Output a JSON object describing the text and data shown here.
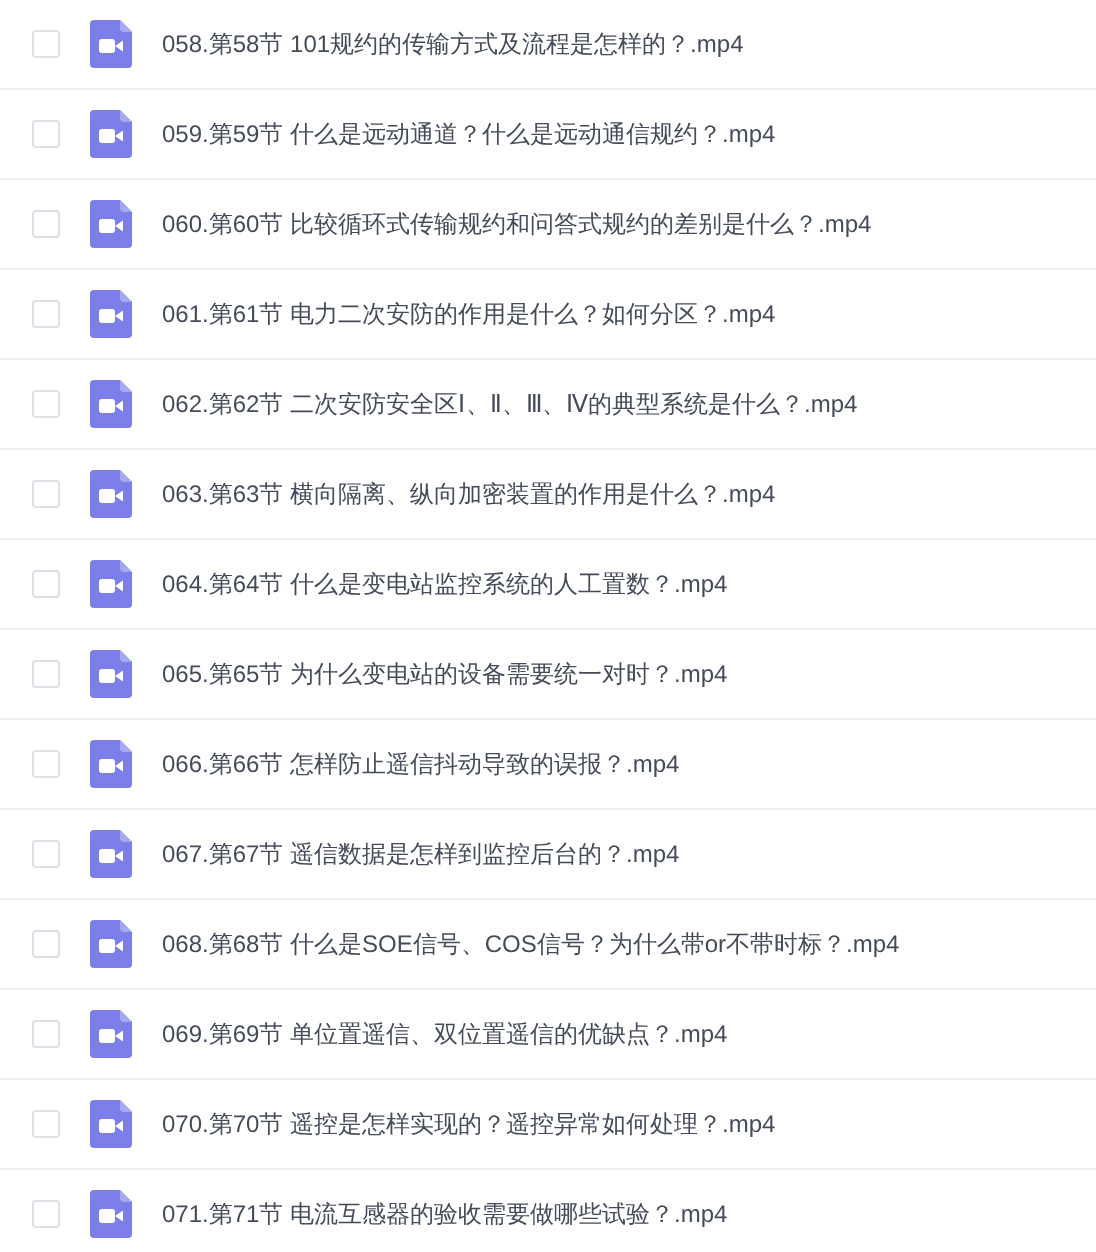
{
  "files": [
    {
      "name": "058.第58节 101规约的传输方式及流程是怎样的？.mp4",
      "checked": false
    },
    {
      "name": "059.第59节 什么是远动通道？什么是远动通信规约？.mp4",
      "checked": false
    },
    {
      "name": "060.第60节 比较循环式传输规约和问答式规约的差别是什么？.mp4",
      "checked": false
    },
    {
      "name": "061.第61节 电力二次安防的作用是什么？如何分区？.mp4",
      "checked": false
    },
    {
      "name": "062.第62节 二次安防安全区Ⅰ、Ⅱ、Ⅲ、Ⅳ的典型系统是什么？.mp4",
      "checked": false
    },
    {
      "name": "063.第63节 横向隔离、纵向加密装置的作用是什么？.mp4",
      "checked": false
    },
    {
      "name": "064.第64节 什么是变电站监控系统的人工置数？.mp4",
      "checked": false
    },
    {
      "name": "065.第65节 为什么变电站的设备需要统一对时？.mp4",
      "checked": false
    },
    {
      "name": "066.第66节 怎样防止遥信抖动导致的误报？.mp4",
      "checked": false
    },
    {
      "name": "067.第67节 遥信数据是怎样到监控后台的？.mp4",
      "checked": false
    },
    {
      "name": "068.第68节 什么是SOE信号、COS信号？为什么带or不带时标？.mp4",
      "checked": false
    },
    {
      "name": "069.第69节 单位置遥信、双位置遥信的优缺点？.mp4",
      "checked": false
    },
    {
      "name": "070.第70节 遥控是怎样实现的？遥控异常如何处理？.mp4",
      "checked": false
    },
    {
      "name": "071.第71节 电流互感器的验收需要做哪些试验？.mp4",
      "checked": false
    }
  ]
}
